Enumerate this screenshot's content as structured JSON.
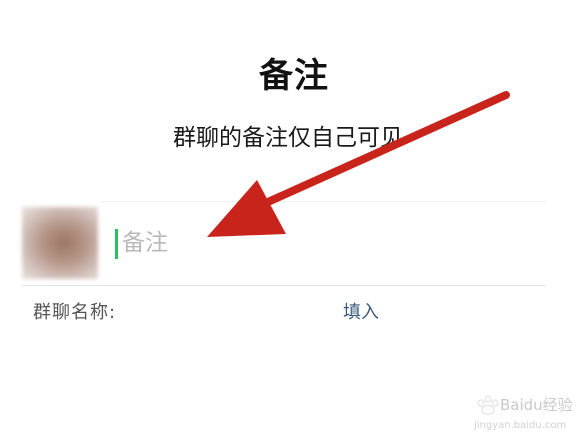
{
  "dialog": {
    "title": "备注",
    "subtitle": "群聊的备注仅自己可见"
  },
  "remark_field": {
    "placeholder": "备注",
    "value": ""
  },
  "group_name": {
    "label": "群聊名称:",
    "fill_action": "填入"
  },
  "annotation": {
    "arrow_color": "#c8241c"
  },
  "watermark": {
    "brand": "Baidu经验",
    "url": "jingyan.baidu.com"
  },
  "colors": {
    "caret": "#2bbf5e",
    "fill_link": "#3d5a7e"
  }
}
